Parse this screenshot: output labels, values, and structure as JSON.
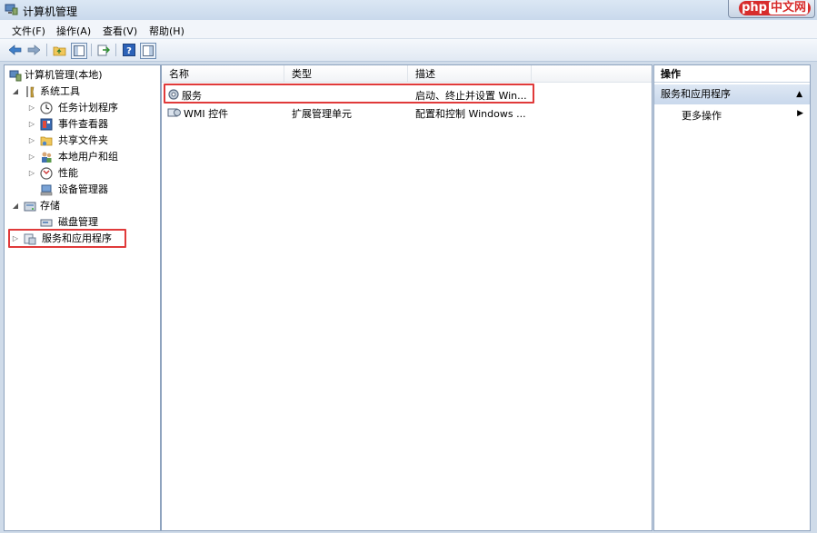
{
  "window": {
    "title": "计算机管理",
    "watermark_php": "php",
    "watermark_cn": "中文网"
  },
  "menu": [
    "文件(F)",
    "操作(A)",
    "查看(V)",
    "帮助(H)"
  ],
  "toolbar": {
    "icons": [
      "back-arrow-icon",
      "forward-arrow-icon",
      "folder-up-icon",
      "console-tree-icon",
      "export-list-icon",
      "help-icon",
      "properties-pane-icon"
    ]
  },
  "tree": {
    "root": "计算机管理(本地)",
    "system_tools": "系统工具",
    "task_scheduler": "任务计划程序",
    "event_viewer": "事件查看器",
    "shared_folders": "共享文件夹",
    "local_users": "本地用户和组",
    "performance": "性能",
    "device_manager": "设备管理器",
    "storage": "存储",
    "disk_management": "磁盘管理",
    "services_apps": "服务和应用程序",
    "expand_open": "◢",
    "expand_closed": "▷"
  },
  "list": {
    "columns": [
      "名称",
      "类型",
      "描述"
    ],
    "rows": [
      {
        "name": "服务",
        "type": "",
        "desc": "启动、终止并设置 Win..."
      },
      {
        "name": "WMI 控件",
        "type": "扩展管理单元",
        "desc": "配置和控制 Windows ..."
      }
    ]
  },
  "actions": {
    "header": "操作",
    "section": "服务和应用程序",
    "section_arrow": "▲",
    "more": "更多操作",
    "more_arrow": "▶"
  },
  "colors": {
    "highlight_red": "#e03a3a",
    "section_blue": "#c9d8ec"
  }
}
